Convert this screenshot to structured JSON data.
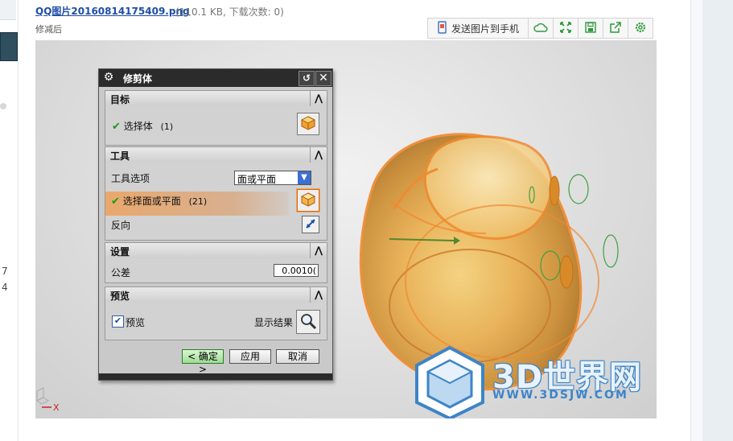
{
  "header": {
    "file_link": "QQ图片20160814175409.png",
    "file_meta": "(110.1 KB, 下载次数: 0)",
    "caption": "修减后"
  },
  "toolbar": {
    "send_label": "发送图片到手机",
    "icons": [
      "phone-send-icon",
      "cloud-icon",
      "fullscreen-icon",
      "save-icon",
      "share-icon",
      "settings-icon"
    ]
  },
  "left_strip": {
    "nums": [
      "7",
      "4"
    ]
  },
  "dialog": {
    "title": "修剪体",
    "target": {
      "header": "目标",
      "select_body": "选择体",
      "select_body_count": "(1)"
    },
    "tool": {
      "header": "工具",
      "option_label": "工具选项",
      "option_value": "面或平面",
      "select_face": "选择面或平面",
      "select_face_count": "(21)",
      "reverse_label": "反向"
    },
    "settings": {
      "header": "设置",
      "tolerance_label": "公差",
      "tolerance_value": "0.0010("
    },
    "preview": {
      "header": "预览",
      "preview_label": "预览",
      "show_result": "显示结果"
    },
    "buttons": {
      "ok": "< 确定 >",
      "apply": "应用",
      "cancel": "取消"
    }
  },
  "watermark": {
    "main": "3D世界网",
    "sub": "WWW.3DSJW.COM"
  },
  "triad": {
    "x_label": "X"
  },
  "colors": {
    "accent_link": "#1f4ea8",
    "ok_green": "#9fdc94",
    "model_orange": "#f0a050"
  }
}
